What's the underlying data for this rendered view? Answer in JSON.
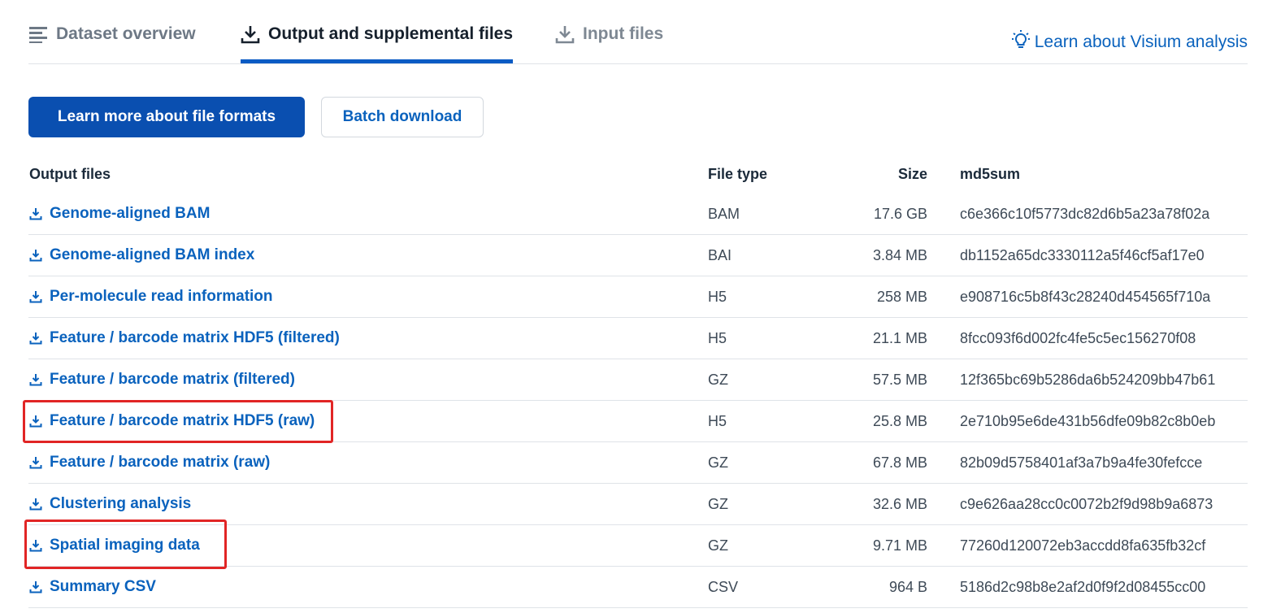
{
  "tabs": {
    "overview": "Dataset overview",
    "output": "Output and supplemental files",
    "input": "Input files"
  },
  "learn_link": "Learn about Visium analysis",
  "buttons": {
    "learn_more": "Learn more about file formats",
    "batch": "Batch download"
  },
  "table": {
    "headers": {
      "name": "Output files",
      "type": "File type",
      "size": "Size",
      "md5": "md5sum"
    },
    "rows": [
      {
        "name": "Genome-aligned BAM",
        "type": "BAM",
        "size": "17.6 GB",
        "md5": "c6e366c10f5773dc82d6b5a23a78f02a"
      },
      {
        "name": "Genome-aligned BAM index",
        "type": "BAI",
        "size": "3.84 MB",
        "md5": "db1152a65dc3330112a5f46cf5af17e0"
      },
      {
        "name": "Per-molecule read information",
        "type": "H5",
        "size": "258 MB",
        "md5": "e908716c5b8f43c28240d454565f710a"
      },
      {
        "name": "Feature / barcode matrix HDF5 (filtered)",
        "type": "H5",
        "size": "21.1 MB",
        "md5": "8fcc093f6d002fc4fe5c5ec156270f08"
      },
      {
        "name": "Feature / barcode matrix (filtered)",
        "type": "GZ",
        "size": "57.5 MB",
        "md5": "12f365bc69b5286da6b524209bb47b61"
      },
      {
        "name": "Feature / barcode matrix HDF5 (raw)",
        "type": "H5",
        "size": "25.8 MB",
        "md5": "2e710b95e6de431b56dfe09b82c8b0eb"
      },
      {
        "name": "Feature / barcode matrix (raw)",
        "type": "GZ",
        "size": "67.8 MB",
        "md5": "82b09d5758401af3a7b9a4fe30fefcce"
      },
      {
        "name": "Clustering analysis",
        "type": "GZ",
        "size": "32.6 MB",
        "md5": "c9e626aa28cc0c0072b2f9d98b9a6873"
      },
      {
        "name": "Spatial imaging data",
        "type": "GZ",
        "size": "9.71 MB",
        "md5": "77260d120072eb3accdd8fa635fb32cf"
      },
      {
        "name": "Summary CSV",
        "type": "CSV",
        "size": "964 B",
        "md5": "5186d2c98b8e2af2d0f9f2d08455cc00"
      }
    ]
  },
  "colors": {
    "accent": "#0a62bd",
    "primary_button": "#0a4fb0",
    "highlight": "#e12525"
  }
}
